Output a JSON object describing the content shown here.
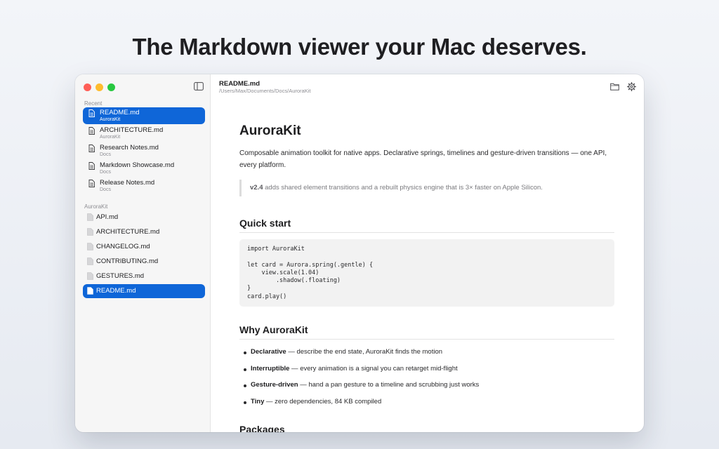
{
  "hero": {
    "title": "The Markdown viewer your Mac deserves."
  },
  "sidebar": {
    "recent_label": "Recent",
    "recent": [
      {
        "name": "README.md",
        "folder": "AuroraKit"
      },
      {
        "name": "ARCHITECTURE.md",
        "folder": "AuroraKit"
      },
      {
        "name": "Research Notes.md",
        "folder": "Docs"
      },
      {
        "name": "Markdown Showcase.md",
        "folder": "Docs"
      },
      {
        "name": "Release Notes.md",
        "folder": "Docs"
      }
    ],
    "project_label": "AuroraKit",
    "files": [
      {
        "name": "API.md"
      },
      {
        "name": "ARCHITECTURE.md"
      },
      {
        "name": "CHANGELOG.md"
      },
      {
        "name": "CONTRIBUTING.md"
      },
      {
        "name": "GESTURES.md"
      },
      {
        "name": "README.md"
      }
    ]
  },
  "toolbar": {
    "doc_title": "README.md",
    "doc_path": "/Users/Max/Documents/Docs/AuroraKit",
    "folder_icon": "folder-icon",
    "settings_icon": "gear-icon"
  },
  "document": {
    "title": "AuroraKit",
    "intro": "Composable animation toolkit for native apps. Declarative springs, timelines and gesture-driven transitions — one API, every platform.",
    "quote_bold": "v2.4",
    "quote_rest": " adds shared element transitions and a rebuilt physics engine that is 3× faster on Apple Silicon.",
    "quick_start_heading": "Quick start",
    "code": "import AuroraKit\n\nlet card = Aurora.spring(.gentle) {\n    view.scale(1.04)\n        .shadow(.floating)\n}\ncard.play()",
    "why_heading": "Why AuroraKit",
    "bullets": [
      {
        "term": "Declarative",
        "text": " — describe the end state, AuroraKit finds the motion"
      },
      {
        "term": "Interruptible",
        "text": " — every animation is a signal you can retarget mid-flight"
      },
      {
        "term": "Gesture-driven",
        "text": " — hand a pan gesture to a timeline and scrubbing just works"
      },
      {
        "term": "Tiny",
        "text": " — zero dependencies, 84 KB compiled"
      }
    ],
    "packages_heading": "Packages"
  },
  "colors": {
    "accent": "#0f66d8",
    "traffic_red": "#ff5f57",
    "traffic_yellow": "#febc2e",
    "traffic_green": "#28c840"
  }
}
